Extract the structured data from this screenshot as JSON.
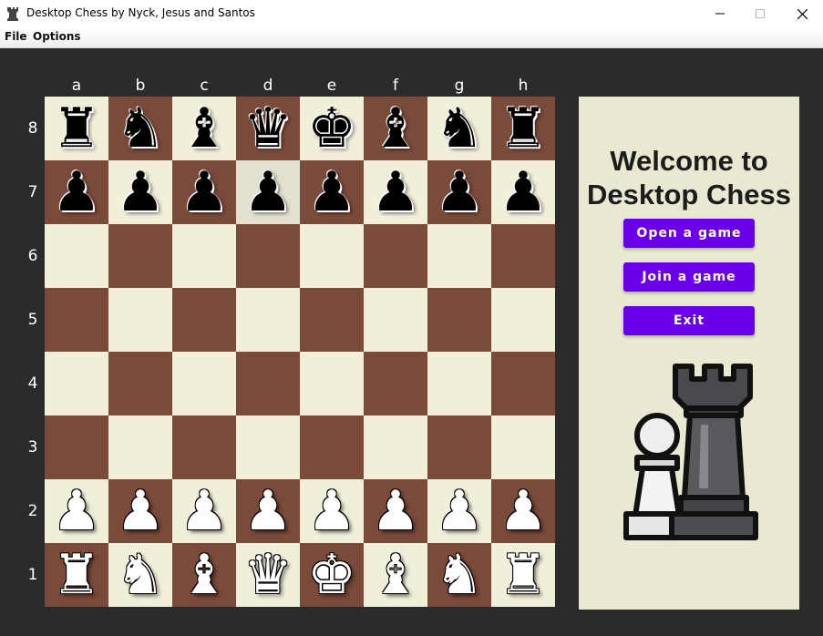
{
  "window": {
    "title": "Desktop Chess by Nyck, Jesus and Santos",
    "buttons": {
      "minimize": "—",
      "maximize": "☐",
      "close": "✕"
    }
  },
  "menu": {
    "items": [
      "File",
      "Options"
    ]
  },
  "board": {
    "files": [
      "a",
      "b",
      "c",
      "d",
      "e",
      "f",
      "g",
      "h"
    ],
    "ranks": [
      "8",
      "7",
      "6",
      "5",
      "4",
      "3",
      "2",
      "1"
    ],
    "colors": {
      "light": "#f2efd9",
      "dark": "#7a4a3a"
    },
    "position": [
      [
        "br",
        "bn",
        "bb",
        "bq",
        "bk",
        "bb",
        "bn",
        "br"
      ],
      [
        "bp",
        "bp",
        "bp",
        "bp",
        "bp",
        "bp",
        "bp",
        "bp"
      ],
      [
        "",
        "",
        "",
        "",
        "",
        "",
        "",
        ""
      ],
      [
        "",
        "",
        "",
        "",
        "",
        "",
        "",
        ""
      ],
      [
        "",
        "",
        "",
        "",
        "",
        "",
        "",
        ""
      ],
      [
        "",
        "",
        "",
        "",
        "",
        "",
        "",
        ""
      ],
      [
        "wp",
        "wp",
        "wp",
        "wp",
        "wp",
        "wp",
        "wp",
        "wp"
      ],
      [
        "wr",
        "wn",
        "wb",
        "wq",
        "wk",
        "wb",
        "wn",
        "wr"
      ]
    ],
    "highlighted_square": "d7"
  },
  "panel": {
    "welcome_line1": "Welcome to",
    "welcome_line2": "Desktop Chess",
    "open_label": "Open a game",
    "join_label": "Join a game",
    "exit_label": "Exit",
    "button_color": "#6a00ea",
    "logo_icon": "chess-pawn-rook-logo"
  }
}
